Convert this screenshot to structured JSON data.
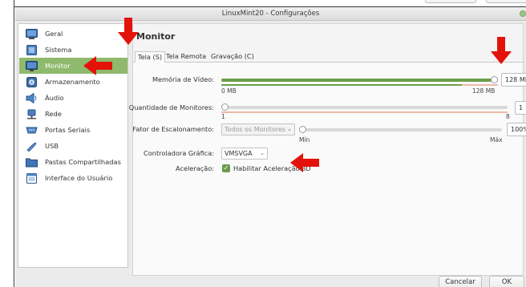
{
  "window": {
    "title": "LinuxMint20 - Configurações"
  },
  "sidebar": {
    "items": [
      {
        "label": "Geral",
        "icon": "general-icon"
      },
      {
        "label": "Sistema",
        "icon": "system-icon"
      },
      {
        "label": "Monitor",
        "icon": "monitor-icon",
        "active": true
      },
      {
        "label": "Armazenamento",
        "icon": "storage-icon"
      },
      {
        "label": "Áudio",
        "icon": "audio-icon"
      },
      {
        "label": "Rede",
        "icon": "network-icon"
      },
      {
        "label": "Portas Seriais",
        "icon": "serial-ports-icon"
      },
      {
        "label": "USB",
        "icon": "usb-icon"
      },
      {
        "label": "Pastas Compartilhadas",
        "icon": "shared-folders-icon"
      },
      {
        "label": "Interface do Usuário",
        "icon": "user-interface-icon"
      }
    ]
  },
  "main": {
    "heading": "Monitor",
    "tabs": [
      {
        "label": "Tela (S)",
        "active": true
      },
      {
        "label": "Tela Remota"
      },
      {
        "label": "Gravação (C)"
      }
    ],
    "video_memory": {
      "label": "Memória de Vídeo:",
      "value": "128 MB",
      "min_label": "0 MB",
      "max_label": "128 MB",
      "fraction": 1.0
    },
    "monitor_count": {
      "label": "Quantidade de Monitores:",
      "value": "1",
      "min_label": "1",
      "max_label": "8",
      "fraction": 0.0
    },
    "scale_factor": {
      "label": "Fator de Escalonamento:",
      "combo_value": "Todos os Monitores",
      "value": "100%",
      "min_label": "Mín",
      "max_label": "Máx",
      "fraction": 0.0
    },
    "graphics_controller": {
      "label": "Controladora Gráfica:",
      "value": "VMSVGA"
    },
    "acceleration": {
      "label": "Aceleração:",
      "checkbox_label": "Habilitar Aceleração 3D",
      "checked": true
    }
  },
  "buttons": {
    "cancel": "Cancelar",
    "ok": "OK"
  },
  "colors": {
    "accent": "#8fb96d",
    "slider_fill": "#6a9f4b",
    "annotation_arrow": "#e3120b",
    "slider_warn": "#f0b8a6"
  }
}
